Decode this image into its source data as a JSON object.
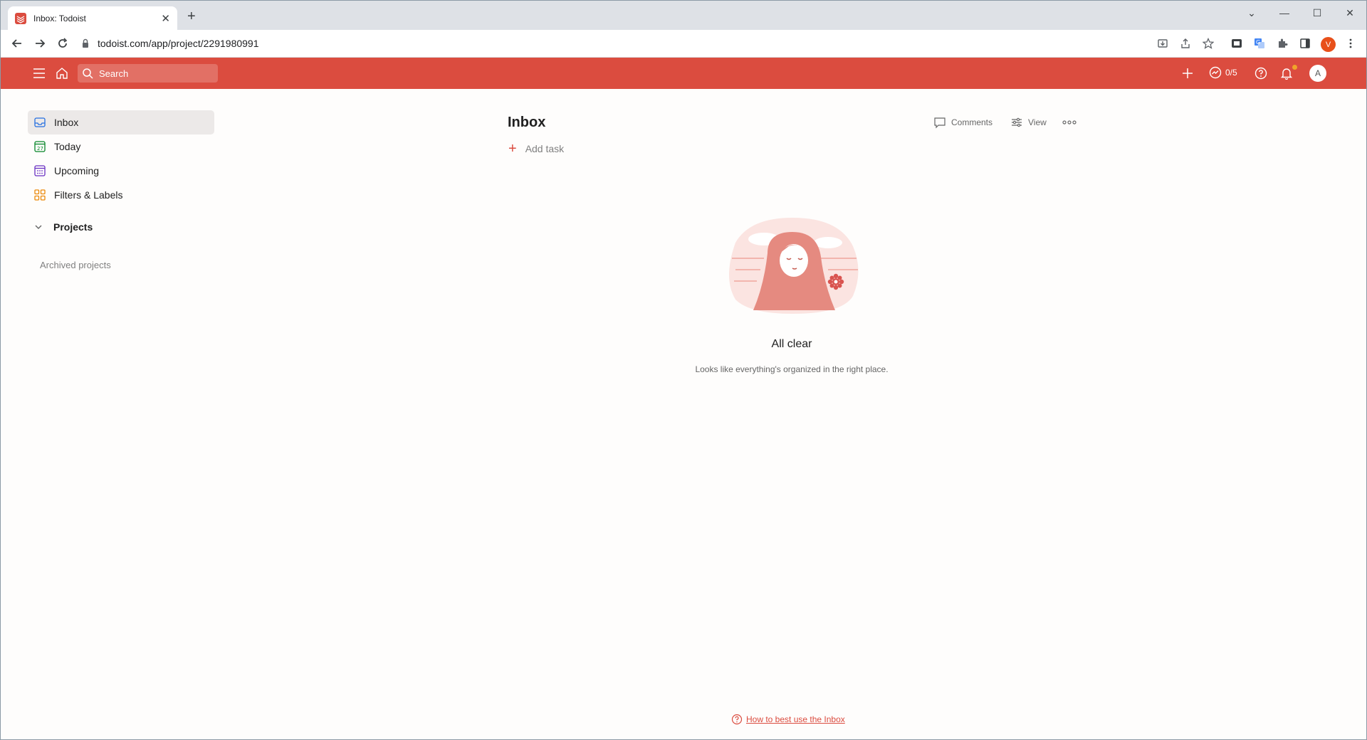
{
  "browser": {
    "tab_title": "Inbox: Todoist",
    "url": "todoist.com/app/project/2291980991",
    "profile_initial": "V"
  },
  "appbar": {
    "search_placeholder": "Search",
    "karma_text": "0/5",
    "avatar_initial": "A",
    "brand_color": "#db4c3f"
  },
  "sidebar": {
    "items": [
      {
        "label": "Inbox",
        "icon": "inbox-icon"
      },
      {
        "label": "Today",
        "icon": "calendar-today-icon"
      },
      {
        "label": "Upcoming",
        "icon": "calendar-grid-icon"
      },
      {
        "label": "Filters & Labels",
        "icon": "filters-grid-icon"
      }
    ],
    "today_day": "27",
    "projects_label": "Projects",
    "archived_label": "Archived projects"
  },
  "main": {
    "title": "Inbox",
    "add_task_label": "Add task",
    "comments_label": "Comments",
    "view_label": "View",
    "empty_title": "All clear",
    "empty_subtitle": "Looks like everything's organized in the right place.",
    "help_link": "How to best use the Inbox"
  }
}
